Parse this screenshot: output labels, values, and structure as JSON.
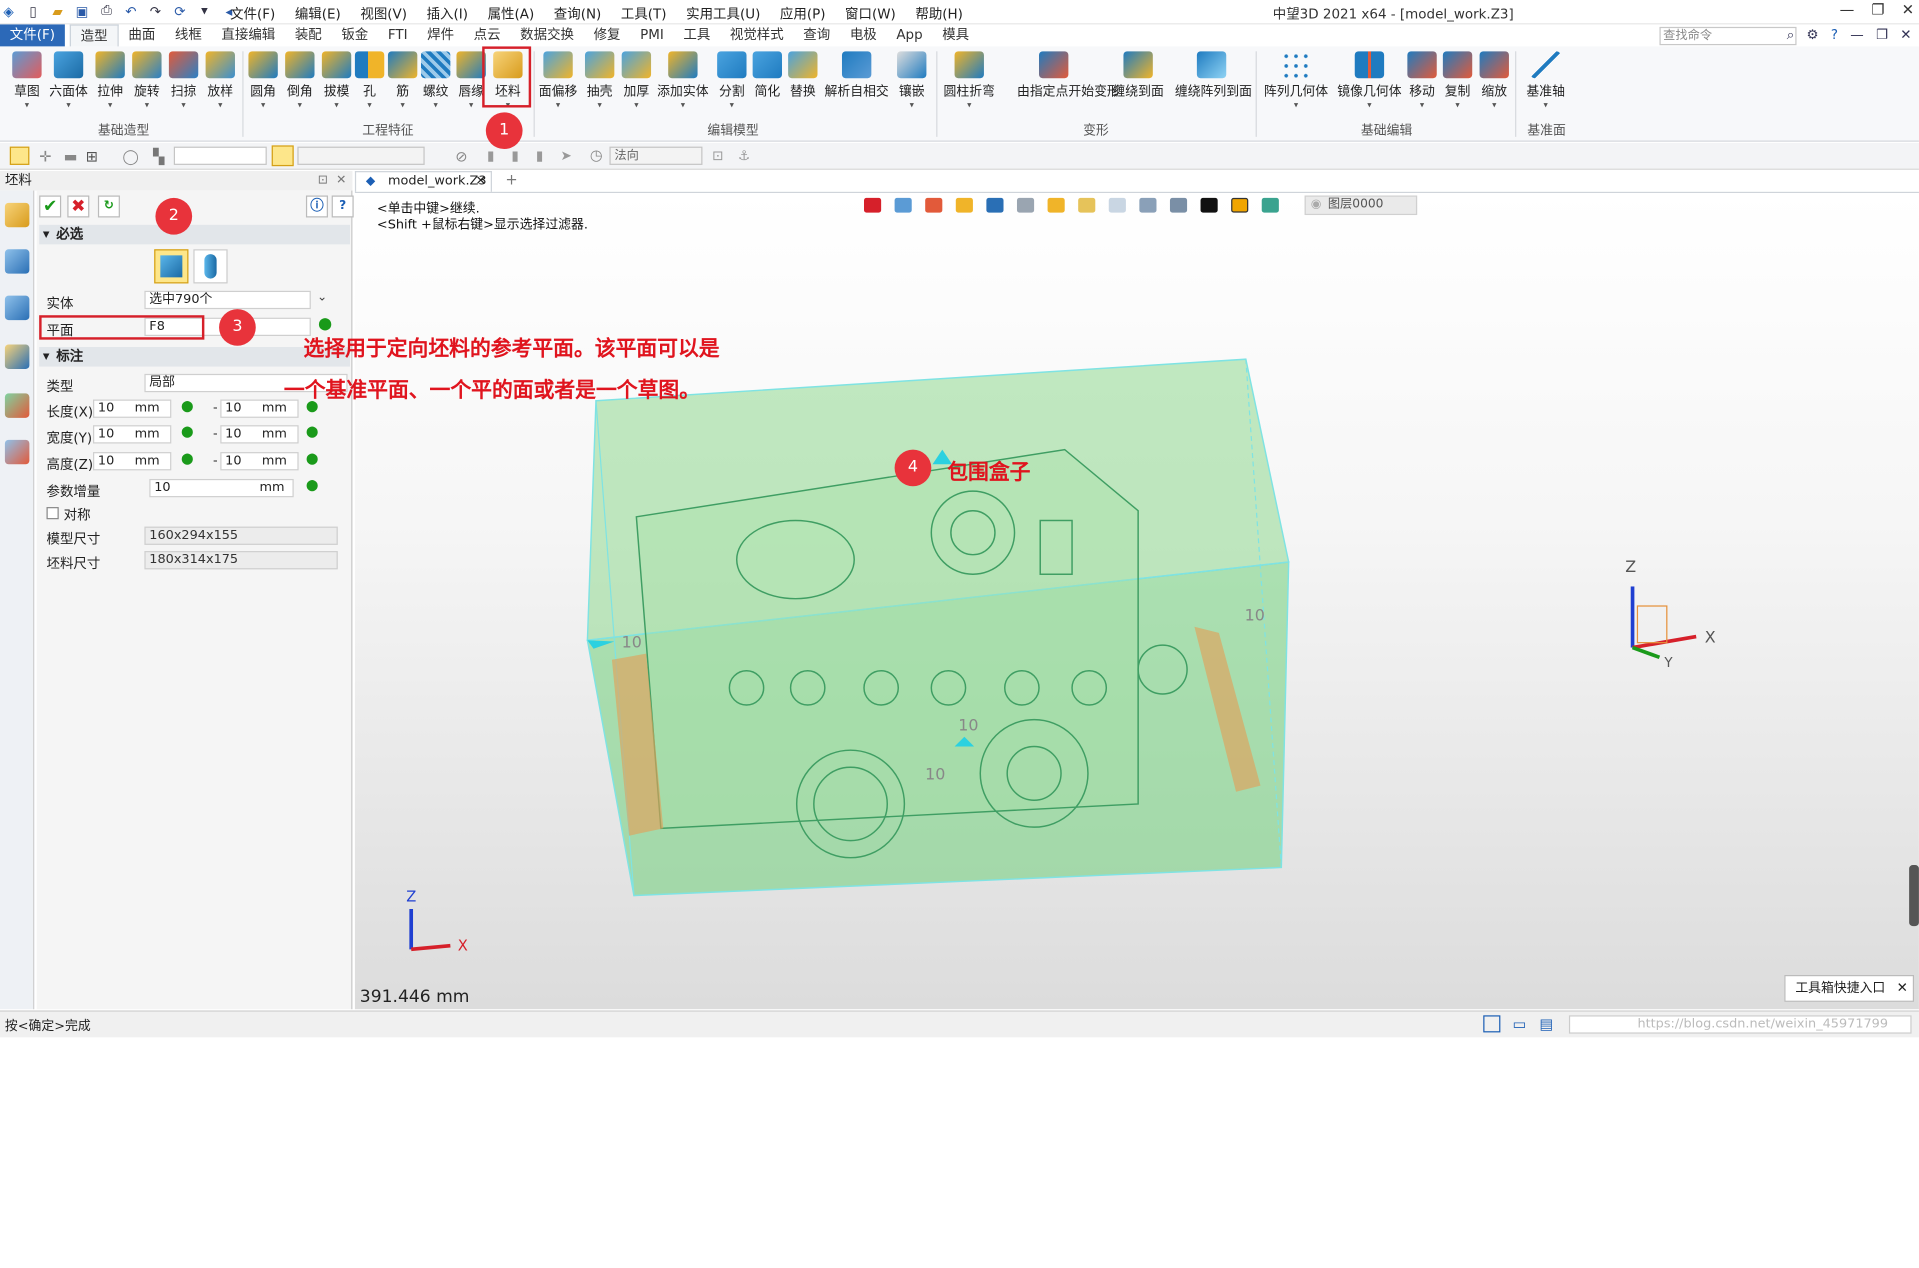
{
  "title": {
    "menus": [
      "文件(F)",
      "编辑(E)",
      "视图(V)",
      "插入(I)",
      "属性(A)",
      "查询(N)",
      "工具(T)",
      "实用工具(U)",
      "应用(P)",
      "窗口(W)",
      "帮助(H)"
    ],
    "window_title": "中望3D 2021 x64 - [model_work.Z3]"
  },
  "ribbon": {
    "file_tab": "文件(F)",
    "tabs": [
      "造型",
      "曲面",
      "线框",
      "直接编辑",
      "装配",
      "钣金",
      "FTI",
      "焊件",
      "点云",
      "数据交换",
      "修复",
      "PMI",
      "工具",
      "视觉样式",
      "查询",
      "电极",
      "App",
      "模具"
    ],
    "search_placeholder": "查找命令",
    "buttons": [
      "草图",
      "六面体",
      "拉伸",
      "旋转",
      "扫掠",
      "放样",
      "圆角",
      "倒角",
      "拔模",
      "孔",
      "筋",
      "螺纹",
      "唇缘",
      "坯料",
      "面偏移",
      "抽壳",
      "加厚",
      "添加实体",
      "分割",
      "简化",
      "替换",
      "解析自相交",
      "镶嵌",
      "圆柱折弯",
      "由指定点开始变形",
      "缠绕到面",
      "缠绕阵列到面",
      "阵列几何体",
      "镜像几何体",
      "移动",
      "复制",
      "缩放",
      "基准轴"
    ],
    "groups": [
      "基础造型",
      "工程特征",
      "编辑模型",
      "变形",
      "基础编辑",
      "基准面"
    ]
  },
  "toolbar2": {
    "dir": "法向"
  },
  "panel": {
    "title": "坯料",
    "required": "必选",
    "entity_label": "实体",
    "entity_value": "选中790个",
    "plane_label": "平面",
    "plane_value": "F8",
    "annot": "标注",
    "type_label": "类型",
    "type_value": "局部",
    "len_label": "长度(X)+",
    "wid_label": "宽度(Y)+",
    "hgt_label": "高度(Z)+",
    "v10": "10",
    "unit": "mm",
    "dash": "-",
    "step_label": "参数增量",
    "step_value": "10",
    "sym_label": "对称",
    "model_label": "模型尺寸",
    "model_value": "160x294x155",
    "blank_label": "坯料尺寸",
    "blank_value": "180x314x175"
  },
  "doc": {
    "tab": "model_work.Z3",
    "hint1": "<单击中键>继续.",
    "hint2": "<Shift +鼠标右键>显示选择过滤器.",
    "layer": "图层0000",
    "measure": "391.446 mm"
  },
  "annotations": {
    "b1": "1",
    "b2": "2",
    "b3": "3",
    "b4": "4",
    "text1": "选择用于定向坯料的参考平面。该平面可以是",
    "text2": "一个基准平面、一个平的面或者是一个草图。",
    "box_label": "包围盒子"
  },
  "axes": {
    "x": "X",
    "y": "Y",
    "z": "Z",
    "dim": "10"
  },
  "status": {
    "left": "按<确定>完成",
    "popup": "工具箱快捷入口",
    "watermark": "https://blog.csdn.net/weixin_45971799"
  }
}
